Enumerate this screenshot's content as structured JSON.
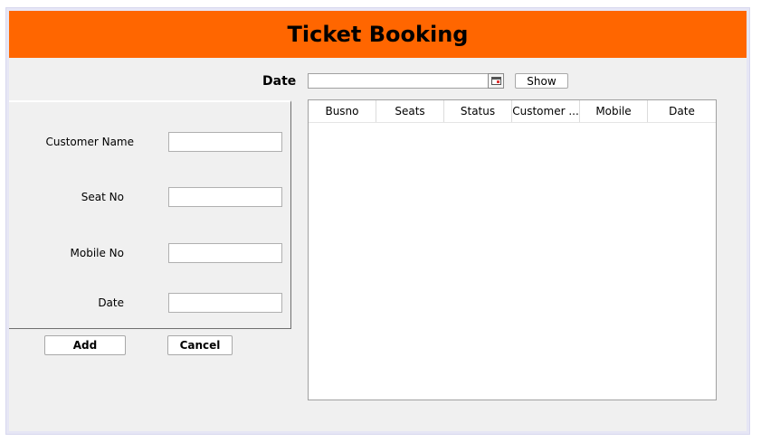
{
  "app": {
    "title": "Ticket Booking"
  },
  "filter": {
    "date_label": "Date",
    "date_value": "",
    "show_label": "Show"
  },
  "form": {
    "fields": [
      {
        "label": "Customer Name",
        "value": ""
      },
      {
        "label": "Seat No",
        "value": ""
      },
      {
        "label": "Mobile No",
        "value": ""
      },
      {
        "label": "Date",
        "value": ""
      }
    ],
    "add_label": "Add",
    "cancel_label": "Cancel"
  },
  "table": {
    "columns": [
      "Busno",
      "Seats",
      "Status",
      "Customer ...",
      "Mobile",
      "Date"
    ],
    "rows": []
  },
  "colors": {
    "header": "#ff6600",
    "background": "#f0f0f0"
  },
  "icons": {
    "date_picker": "calendar-icon"
  }
}
